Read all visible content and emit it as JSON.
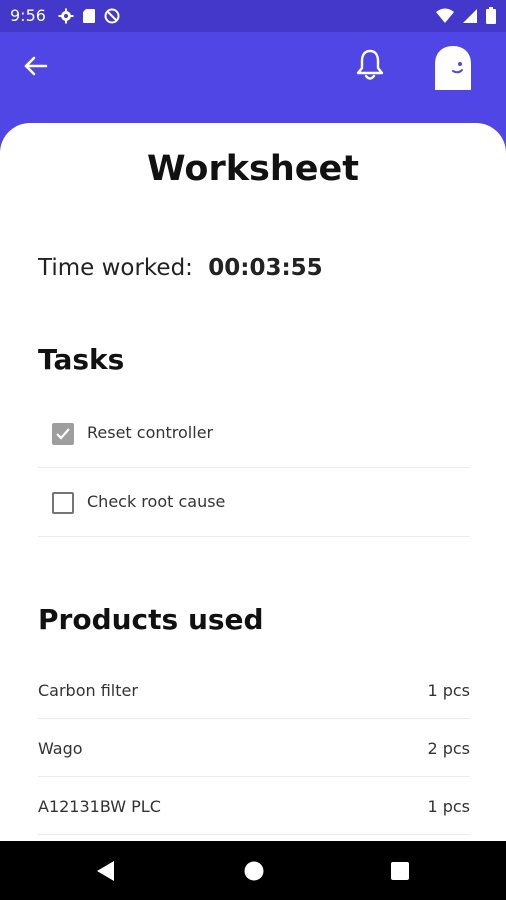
{
  "status_bar": {
    "time": "9:56",
    "left_icons": [
      "gear-icon",
      "sd-card-icon",
      "no-data-icon"
    ],
    "right_icons": [
      "wifi-icon",
      "signal-icon",
      "battery-icon"
    ]
  },
  "app_bar": {
    "back_icon": "arrow-left-icon",
    "notification_icon": "bell-icon",
    "avatar_icon": "ghost-avatar-icon",
    "color": "#4f46e5"
  },
  "worksheet": {
    "title": "Worksheet",
    "time_label": "Time worked:",
    "time_value": "00:03:55"
  },
  "tasks": {
    "title": "Tasks",
    "items": [
      {
        "label": "Reset controller",
        "checked": true
      },
      {
        "label": "Check root cause",
        "checked": false
      }
    ]
  },
  "products": {
    "title": "Products used",
    "items": [
      {
        "name": "Carbon filter",
        "quantity": "1 pcs"
      },
      {
        "name": "Wago",
        "quantity": "2 pcs"
      },
      {
        "name": "A12131BW PLC",
        "quantity": "1 pcs"
      }
    ]
  },
  "nav_bar": {
    "icons": [
      "back-triangle-icon",
      "home-circle-icon",
      "recents-square-icon"
    ]
  }
}
